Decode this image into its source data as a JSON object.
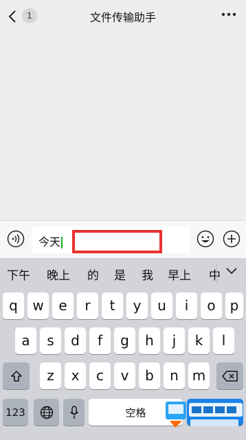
{
  "header": {
    "back_icon": "chevron-left-icon",
    "unread_count": "1",
    "title": "文件传输助手",
    "more_icon": "more-horizontal-icon"
  },
  "input": {
    "value": "今天",
    "voice_icon": "voice-icon",
    "emoji_icon": "emoji-icon",
    "plus_icon": "plus-icon",
    "highlight_color": "#e8322e"
  },
  "candidates": [
    "下午",
    "晚上",
    "的",
    "是",
    "我",
    "早上",
    "中"
  ],
  "keyboard": {
    "row1": [
      "q",
      "w",
      "e",
      "r",
      "t",
      "y",
      "u",
      "i",
      "o",
      "p"
    ],
    "row2": [
      "a",
      "s",
      "d",
      "f",
      "g",
      "h",
      "j",
      "k",
      "l"
    ],
    "row3": [
      "z",
      "x",
      "c",
      "v",
      "b",
      "n",
      "m"
    ],
    "numbers_label": "123",
    "space_label": "空格",
    "shift_icon": "shift-icon",
    "backspace_icon": "backspace-icon",
    "globe_icon": "globe-icon",
    "mic_icon": "microphone-icon"
  }
}
